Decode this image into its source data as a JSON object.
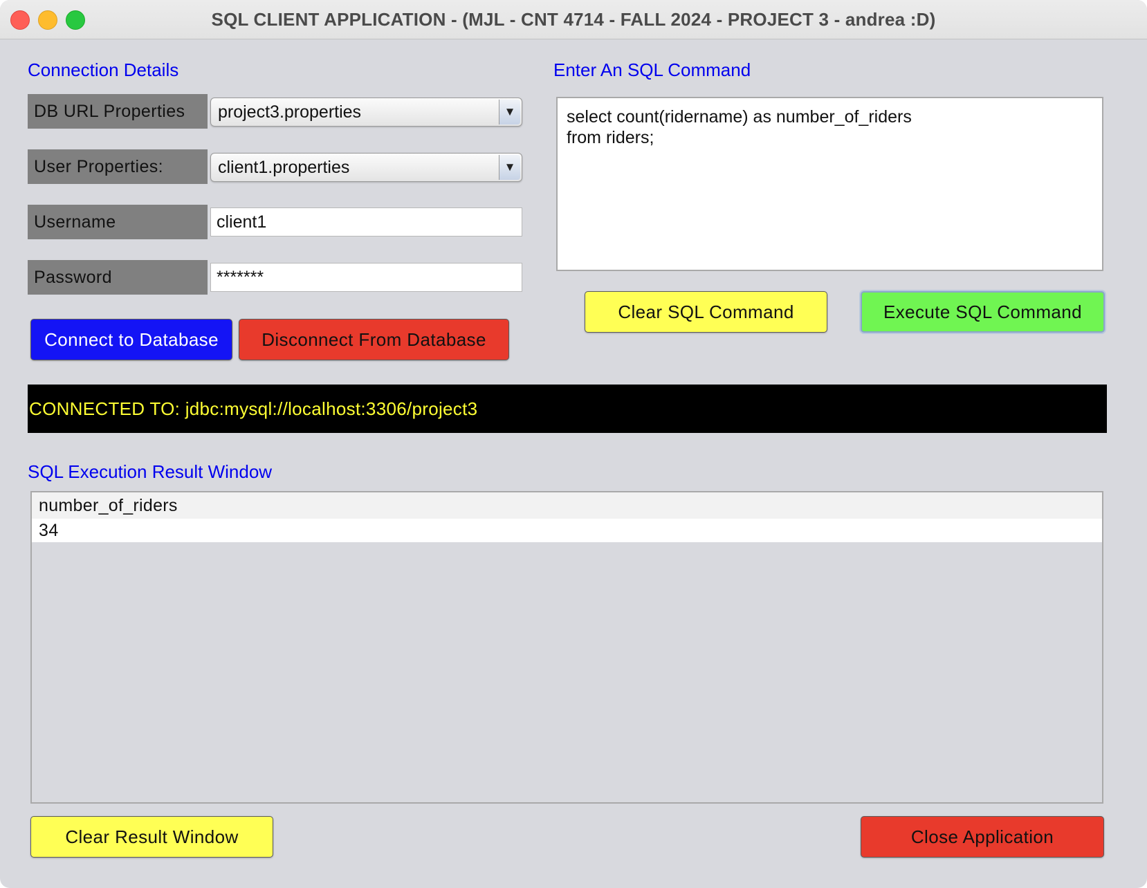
{
  "window": {
    "title": "SQL CLIENT APPLICATION - (MJL - CNT 4714 - FALL 2024 - PROJECT 3 - andrea :D)"
  },
  "connection": {
    "section_label": "Connection Details",
    "db_url_label": "DB URL Properties",
    "db_url_value": "project3.properties",
    "user_props_label": "User Properties:",
    "user_props_value": "client1.properties",
    "username_label": "Username",
    "username_value": "client1",
    "password_label": "Password",
    "password_value": "*******",
    "connect_button": "Connect to Database",
    "disconnect_button": "Disconnect From Database"
  },
  "sql": {
    "section_label": "Enter An SQL Command",
    "command_lines": [
      "select count(ridername) as number_of_riders",
      "from riders;"
    ],
    "clear_button": "Clear SQL Command",
    "execute_button": "Execute SQL Command"
  },
  "status": {
    "text": "CONNECTED TO: jdbc:mysql://localhost:3306/project3"
  },
  "results": {
    "section_label": "SQL Execution Result Window",
    "columns": [
      "number_of_riders"
    ],
    "rows": [
      [
        "34"
      ]
    ],
    "clear_button": "Clear Result Window",
    "close_button": "Close Application"
  },
  "colors": {
    "section_label": "#0000ee",
    "connect_button": "#1414f5",
    "disconnect_button": "#e83a2c",
    "clear_button": "#ffff55",
    "execute_button": "#70f552",
    "close_button": "#e83a2c",
    "status_text": "#ffff33",
    "status_bg": "#000000"
  }
}
